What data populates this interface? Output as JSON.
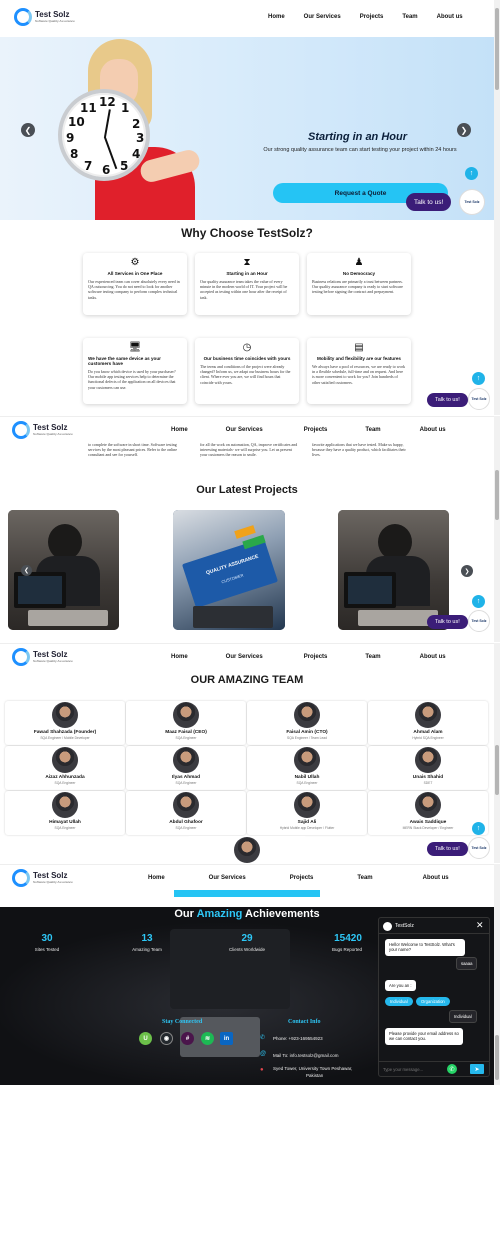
{
  "brand": {
    "name": "Test Solz",
    "tagline": "Software Quality Assurance"
  },
  "nav": [
    "Home",
    "Our Services",
    "Projects",
    "Team",
    "About us"
  ],
  "hero": {
    "title": "Starting in an Hour",
    "subtitle": "Our strong quality assurance team can start testing your project within 24 hours",
    "cta": "Request a Quote",
    "prev": "❮",
    "next": "❯",
    "clock_numbers": [
      "12",
      "1",
      "2",
      "3",
      "4",
      "5",
      "6",
      "7",
      "8",
      "9",
      "10",
      "11"
    ]
  },
  "widget": {
    "talk_label": "Talk to us!",
    "talk_label_short": "Talk to us!",
    "logo_text": "Test Solz",
    "up_icon": "↑"
  },
  "why": {
    "title": "Why Choose TestSolz?",
    "cards": [
      {
        "icon": "⚙",
        "title": "All Services in One Place",
        "text": "Our experienced team can cover absolutely every need in QA outsourcing. You do not need to look for another software testing company to perform complex technical tasks."
      },
      {
        "icon": "⧗",
        "title": "Starting in an Hour",
        "text": "Our quality assurance team takes the value of every minute in the modern world of IT. Your project will be accepted as testing within one hour after the receipt of task."
      },
      {
        "icon": "♟",
        "title": "No Democracy",
        "text": "Business relations are primarily a trust between partners. Our quality assurance company is ready to start software testing before signing the contract and prepayment."
      },
      {
        "icon": "🖥",
        "title": "We have the same device as your customers have",
        "text": "Do you know which device is used by your purchaser? Our mobile app testing services help to determine the functional defects of the application on all devices that your customers can use."
      },
      {
        "icon": "◷",
        "title": "Our business time coincides with yours",
        "text": "The terms and conditions of the project were already changed? Inform us, we adapt our business hours for the client. Where ever you are, we will find hours that coincide with yours."
      },
      {
        "icon": "▤",
        "title": "Mobility and flexibility are our features",
        "text": "We always have a pool of resources, we are ready to work in a flexible schedule, full-time and on request. And here is more convenient to work for you? Join hundreds of other satisfied customers."
      }
    ],
    "partial_texts": [
      "to complete the software in short time. Software testing services by the most pleasant prices. Refer to the online consultant and see for yourself.",
      "for all the work on automation, QA, improve certificates and interesting materials- we will surprise you. Let us present your customers the reason to smile.",
      "favorite applications that we have tested. Make us happy, because they have a quality product, which facilitates their lives."
    ]
  },
  "projects": {
    "title": "Our Latest Projects",
    "card2_label": "QUALITY ASSURANCE",
    "card2_sub": "CUSTOMER"
  },
  "team": {
    "title": "OUR AMAZING TEAM",
    "members": [
      {
        "name": "Fawad Shahzada (Founder)",
        "role": "SQA Engineer / Mobile Developer"
      },
      {
        "name": "Maaz Faisal (CEO)",
        "role": "SQA Engineer"
      },
      {
        "name": "Faisal Amin (CTO)",
        "role": "SQA Engineer / Team Lead"
      },
      {
        "name": "Ahmad Alam",
        "role": "Hybrid SQA Engineer"
      },
      {
        "name": "Aizaz Ahhunzada",
        "role": "SQA Engineer"
      },
      {
        "name": "Ilyas Ahmad",
        "role": "SQA Engineer"
      },
      {
        "name": "Nabil Ullah",
        "role": "SQA Engineer"
      },
      {
        "name": "Unais Shahid",
        "role": "SDET"
      },
      {
        "name": "Himayat Ullah",
        "role": "SQA Engineer"
      },
      {
        "name": "Abdul Ghafoor",
        "role": "SQA Engineer"
      },
      {
        "name": "Sajid Ali",
        "role": "Hybrid Mobile app Developer / Flutter"
      },
      {
        "name": "Awais Saddique",
        "role": "MERN Stack Developer / Engineer"
      }
    ]
  },
  "achievements": {
    "title_prefix": "Our ",
    "title_accent": "Amazing",
    "title_suffix": " Achievements",
    "stats": [
      {
        "value": "30",
        "label": "Sites Tested"
      },
      {
        "value": "13",
        "label": "Amazing Team"
      },
      {
        "value": "29",
        "label": "Clients Worldwide"
      },
      {
        "value": "15420",
        "label": "Bugs Reported"
      }
    ],
    "stay_connected": "Stay Connected",
    "contact_title": "Contact Info",
    "phone": "Phone: +923-169554923",
    "email": "Mail To: info.testsolz@gmail.com",
    "address_line1": "Syed Tower, University Town Peshawar,",
    "address_line2": "Pakistan",
    "social_icons": [
      "upwork-icon",
      "github-icon",
      "slack-icon",
      "spotify-icon",
      "linkedin-icon"
    ]
  },
  "chat": {
    "header": "TestSolz",
    "welcome": "Hello! Welcome to TestSolz. What's your name?",
    "user_reply": "saaaa",
    "question": "Are you an :",
    "options": [
      "Individual",
      "Organization"
    ],
    "selected": "Individual",
    "email_prompt": "Please provide your email address so we can contact you.",
    "placeholder": "Type your message..."
  },
  "colors": {
    "accent": "#25c4f4",
    "brand_purple": "#3b1d78",
    "dark_bg": "#0c0d10"
  }
}
